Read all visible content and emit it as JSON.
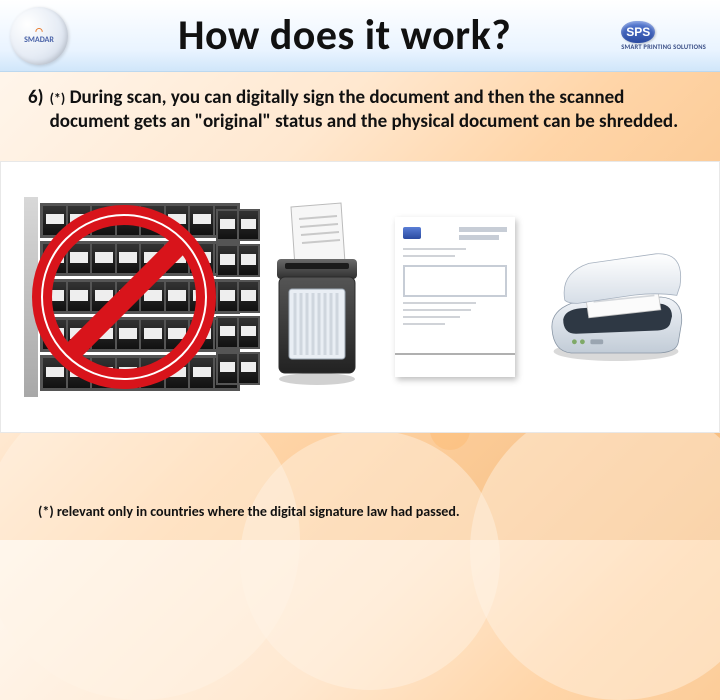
{
  "header": {
    "title": "How does it work?",
    "logo_left": {
      "line1": "SMADAR"
    },
    "logo_right": {
      "mark": "SPS",
      "sub": "SMART PRINTING SOLUTIONS"
    }
  },
  "bullet": {
    "number": "6)",
    "asterisk": "(*)",
    "text": "During scan, you can digitally sign the document and then the scanned document gets an \"original\" status and the physical document can be shredded."
  },
  "footnote": "(*) relevant only in countries where the digital signature law had passed.",
  "images": {
    "archive": "prohibited-archive-shelves-icon",
    "shredder": "paper-shredder-icon",
    "document": "invoice-document-icon",
    "scanner": "desktop-scanner-icon"
  }
}
